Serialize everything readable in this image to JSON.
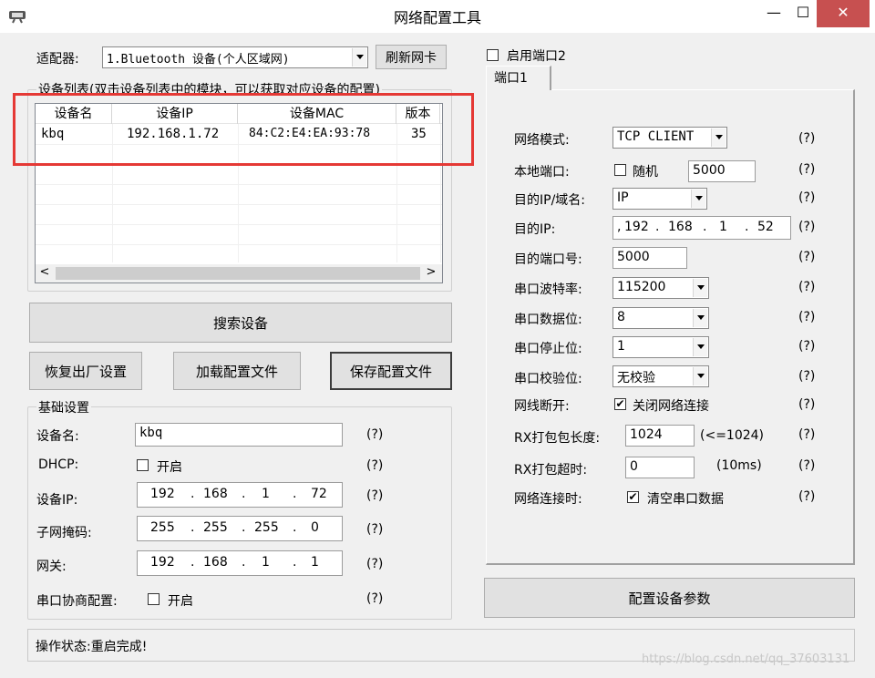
{
  "window": {
    "title": "网络配置工具",
    "minimize": "—",
    "maximize": "☐",
    "close": "✕"
  },
  "adapter": {
    "label": "适配器:",
    "selected": "1.Bluetooth 设备(个人区域网)",
    "refresh_button": "刷新网卡"
  },
  "device_list": {
    "group_title": "设备列表(双击设备列表中的模块，可以获取对应设备的配置)",
    "columns": [
      "设备名",
      "设备IP",
      "设备MAC",
      "版本"
    ],
    "rows": [
      {
        "name": "kbq",
        "ip": "192.168.1.72",
        "mac": "84:C2:E4:EA:93:78",
        "version": "35"
      }
    ],
    "scroll_left": "<",
    "scroll_right": ">"
  },
  "buttons": {
    "search": "搜索设备",
    "restore": "恢复出厂设置",
    "load_config": "加载配置文件",
    "save_config": "保存配置文件",
    "configure": "配置设备参数"
  },
  "basic": {
    "group_title": "基础设置",
    "device_name_label": "设备名:",
    "device_name": "kbq",
    "dhcp_label": "DHCP:",
    "dhcp_option": "开启",
    "device_ip_label": "设备IP:",
    "device_ip": [
      "192",
      "168",
      "1",
      "72"
    ],
    "subnet_label": "子网掩码:",
    "subnet": [
      "255",
      "255",
      "255",
      "0"
    ],
    "gateway_label": "网关:",
    "gateway": [
      "192",
      "168",
      "1",
      "1"
    ],
    "serial_negotiation_label": "串口协商配置:",
    "serial_negotiation_option": "开启",
    "hint": "(?)"
  },
  "port": {
    "enable_port2": "启用端口2",
    "tab1": "端口1",
    "net_mode_label": "网络模式:",
    "net_mode": "TCP CLIENT",
    "local_port_label": "本地端口:",
    "random_label": "随机",
    "local_port": "5000",
    "dest_ip_domain_label": "目的IP/域名:",
    "dest_ip_domain": "IP",
    "dest_ip_label": "目的IP:",
    "dest_ip": [
      "192",
      "168",
      "1",
      "52"
    ],
    "dest_port_label": "目的端口号:",
    "dest_port": "5000",
    "baud_label": "串口波特率:",
    "baud": "115200",
    "databits_label": "串口数据位:",
    "databits": "8",
    "stopbits_label": "串口停止位:",
    "stopbits": "1",
    "parity_label": "串口校验位:",
    "parity": "无校验",
    "disconnect_label": "网线断开:",
    "disconnect_option": "关闭网络连接",
    "rx_len_label": "RX打包包长度:",
    "rx_len": "1024",
    "rx_len_hint": "(<=1024)",
    "rx_timeout_label": "RX打包超时:",
    "rx_timeout": "0",
    "rx_timeout_unit": "(10ms)",
    "net_connect_label": "网络连接时:",
    "net_connect_option": "清空串口数据",
    "hint": "(?)"
  },
  "status": {
    "text": "操作状态:重启完成!"
  },
  "watermark": "https://blog.csdn.net/qq_37603131",
  "colors": {
    "highlight_box": "#e53935",
    "window_bg": "#f0f0f0"
  }
}
